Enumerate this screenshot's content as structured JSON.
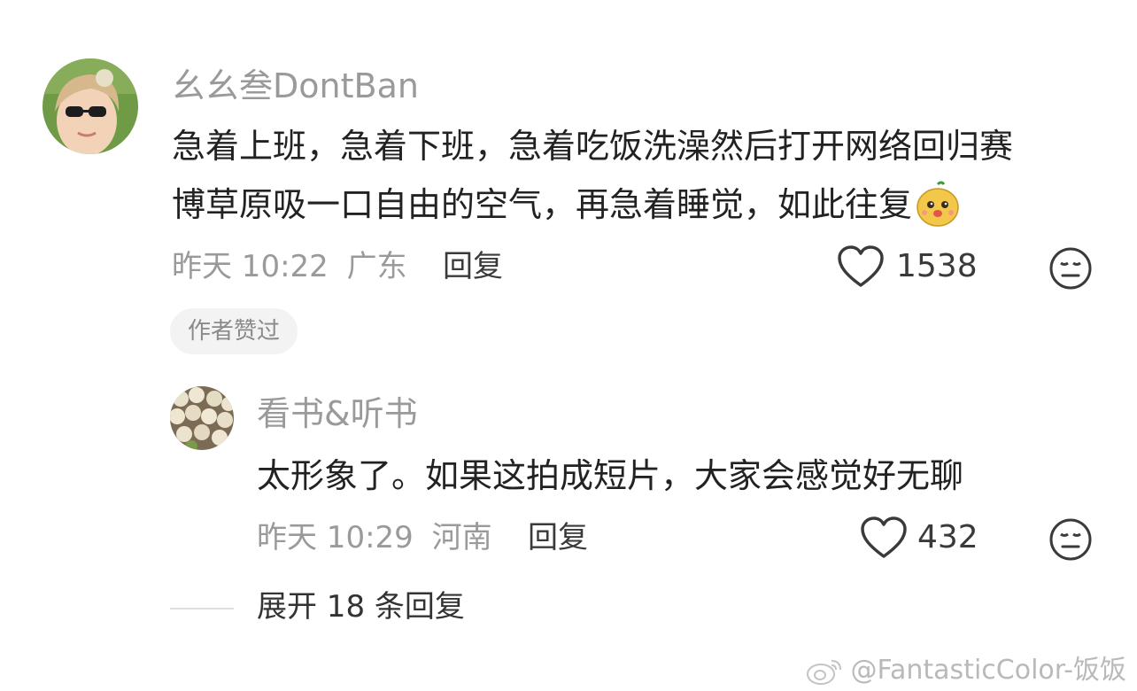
{
  "comments": [
    {
      "username": "幺幺叁DontBan",
      "text_line1": "急着上班，急着下班，急着吃饭洗澡然后打开网络回归赛",
      "text_line2": "博草原吸一口自由的空气，再急着睡觉，如此往复",
      "emoji_icon": "cute-face-emoji",
      "time": "昨天 10:22",
      "location": "广东",
      "reply_label": "回复",
      "likes": "1538",
      "badge": "作者赞过"
    },
    {
      "username": "看书&听书",
      "text": "太形象了。如果这拍成短片，大家会感觉好无聊",
      "time": "昨天 10:29",
      "location": "河南",
      "reply_label": "回复",
      "likes": "432"
    }
  ],
  "expand_replies": "展开 18 条回复",
  "watermark": "@FantasticColor-饭饭",
  "colors": {
    "secondary_text": "#9a9a9a",
    "primary_text": "#222222",
    "badge_bg": "#f3f3f3"
  }
}
